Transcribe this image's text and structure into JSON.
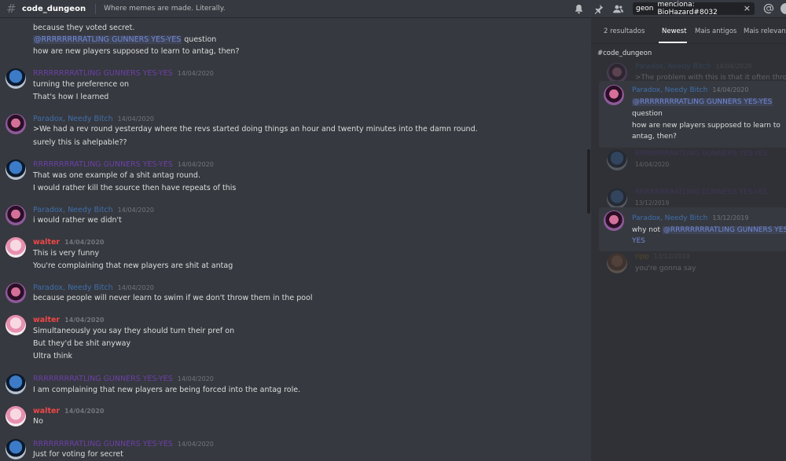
{
  "header": {
    "channel": "code_dungeon",
    "topic": "Where memes are made. Literally.",
    "icons": [
      "bell-icon",
      "pin-icon",
      "members-icon"
    ],
    "search": {
      "tag1": "geon",
      "tag2": "menciona: BioHazard#8032",
      "clear": "×"
    }
  },
  "chat": {
    "top_lines": [
      "because they voted secret.",
      "question",
      "how are new players supposed to learn to antag, then?"
    ],
    "top_mention": "@RRRRRRRRATLING GUNNERS YES-YES",
    "messages": [
      {
        "author": "RRRRRRRRATLING GUNNERS YES-YES",
        "ts": "14/04/2020",
        "lines": [
          "turning the preference on",
          "That's how I learned"
        ]
      },
      {
        "author": "Paradox, Needy Bitch",
        "ts": "14/04/2020",
        "lines": [
          ">We had a rev round yesterday where the revs started doing things an hour and twenty minutes into the damn round.",
          "surely this is ahelpable??"
        ]
      },
      {
        "author": "RRRRRRRRATLING GUNNERS YES-YES",
        "ts": "14/04/2020",
        "lines": [
          "That was one example of a shit antag round.",
          "I would rather kill the source then have repeats of this"
        ]
      },
      {
        "author": "Paradox, Needy Bitch",
        "ts": "14/04/2020",
        "lines": [
          "i would rather we didn't"
        ]
      },
      {
        "author": "walter",
        "ts": "14/04/2020",
        "lines": [
          "This is very funny",
          "You're complaining that new players are shit at antag"
        ]
      },
      {
        "author": "Paradox, Needy Bitch",
        "ts": "14/04/2020",
        "lines": [
          "because people will never learn to swim if we don't throw them in the pool"
        ]
      },
      {
        "author": "walter",
        "ts": "14/04/2020",
        "lines": [
          "Simultaneously you say they should turn their pref on",
          "But they'd be shit anyway",
          "Ultra think"
        ]
      },
      {
        "author": "RRRRRRRRATLING GUNNERS YES-YES",
        "ts": "14/04/2020",
        "lines": [
          "I am complaining that new players are being forced into the antag role."
        ]
      },
      {
        "author": "walter",
        "ts": "14/04/2020",
        "lines": [
          "No"
        ]
      },
      {
        "author": "RRRRRRRRATLING GUNNERS YES-YES",
        "ts": "14/04/2020",
        "lines": [
          "Just for voting for secret"
        ]
      }
    ]
  },
  "panel": {
    "results": "2 resultados",
    "tabs": [
      "Newest",
      "Mais antigos",
      "Mais relevante"
    ],
    "channel": "#code_dungeon",
    "ctx1": {
      "author": "Paradox, Needy Bitch",
      "ts": "14/04/2020",
      "text": ">The problem with this is that it often throws"
    },
    "hit1": {
      "author": "Paradox, Needy Bitch",
      "ts": "14/04/2020",
      "mention": "@RRRRRRRRATLING GUNNERS YES-YES",
      "lines": [
        "question",
        "how are new players supposed to learn to",
        "antag, then?"
      ]
    },
    "ctx2": {
      "author": "RRRRRRRRATLING GUNNERS YES-YES",
      "ts": "14/04/2020"
    },
    "ctx3": {
      "author": "RRRRRRRRATLING GUNNERS YES-YES",
      "ts": "13/12/2019"
    },
    "hit2": {
      "author": "Paradox, Needy Bitch",
      "ts": "13/12/2019",
      "prefix": "why not",
      "mention": "@RRRRRRRRATLING GUNNERS YES",
      "line2": "YES"
    },
    "ctx4": {
      "author": "ripp",
      "ts": "13/12/2019",
      "text": "you're gonna say"
    }
  },
  "colors": {
    "gunner": "#6d3fa8",
    "paradox": "#3f6fae",
    "walter": "#f04747",
    "mention": "#7289da"
  }
}
